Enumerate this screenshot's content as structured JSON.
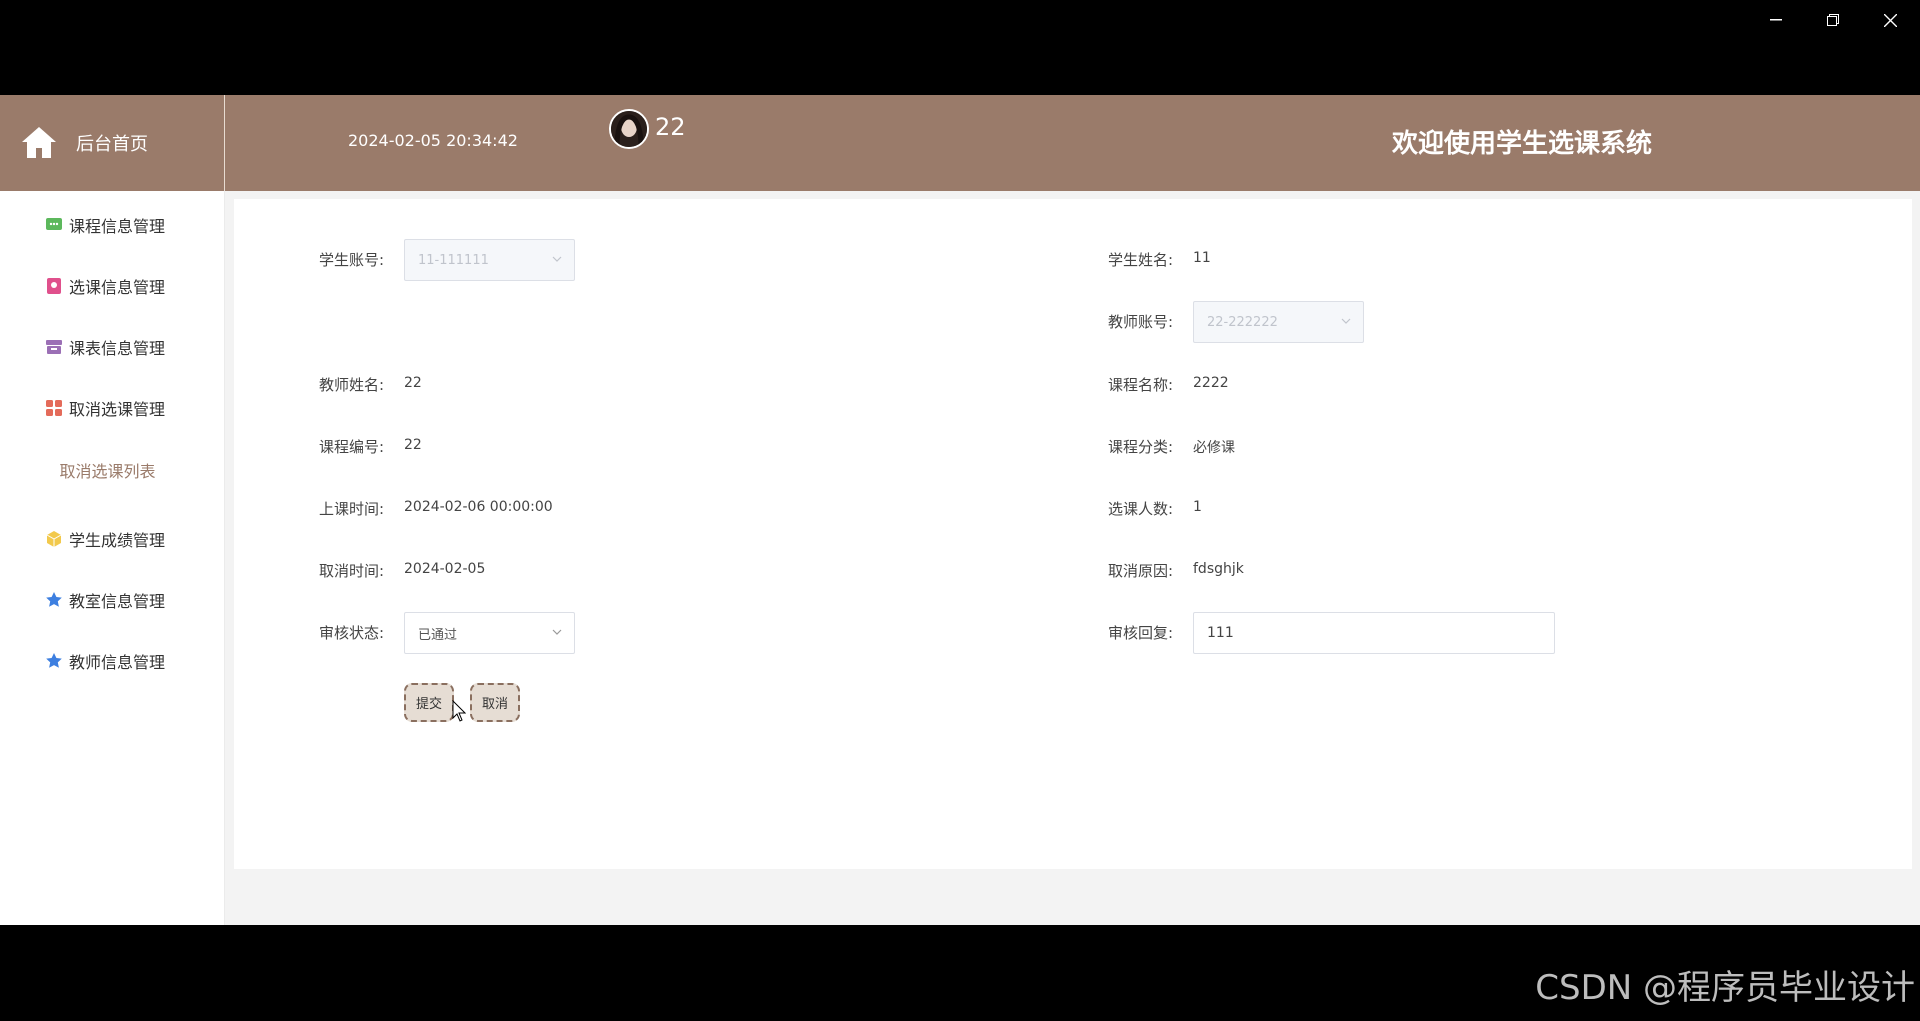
{
  "window": {
    "minimize": "–",
    "restore": "❐",
    "close": "✕"
  },
  "header": {
    "home_label": "后台首页",
    "datetime": "2024-02-05 20:34:42",
    "user_name": "22",
    "welcome": "欢迎使用学生选课系统"
  },
  "sidebar": {
    "items": [
      {
        "label": "课程信息管理",
        "icon": "chat-icon",
        "color": "#5cb85c"
      },
      {
        "label": "选课信息管理",
        "icon": "badge-icon",
        "color": "#e0508c"
      },
      {
        "label": "课表信息管理",
        "icon": "archive-icon",
        "color": "#9b6fb5"
      },
      {
        "label": "取消选课管理",
        "icon": "grid-icon",
        "color": "#e46b5a"
      },
      {
        "sub_label": "取消选课列表"
      },
      {
        "label": "学生成绩管理",
        "icon": "cube-icon",
        "color": "#f2c94c"
      },
      {
        "label": "教室信息管理",
        "icon": "star-icon",
        "color": "#3d7fe0"
      },
      {
        "label": "教师信息管理",
        "icon": "star-icon",
        "color": "#3d7fe0"
      }
    ]
  },
  "form": {
    "student_account": {
      "label": "学生账号:",
      "value": "11-111111"
    },
    "student_name": {
      "label": "学生姓名:",
      "value": "11"
    },
    "teacher_account": {
      "label": "教师账号:",
      "value": "22-222222"
    },
    "teacher_name": {
      "label": "教师姓名:",
      "value": "22"
    },
    "course_name": {
      "label": "课程名称:",
      "value": "2222"
    },
    "course_code": {
      "label": "课程编号:",
      "value": "22"
    },
    "course_category": {
      "label": "课程分类:",
      "value": "必修课"
    },
    "class_time": {
      "label": "上课时间:",
      "value": "2024-02-06 00:00:00"
    },
    "enrolled_count": {
      "label": "选课人数:",
      "value": "1"
    },
    "cancel_time": {
      "label": "取消时间:",
      "value": "2024-02-05"
    },
    "cancel_reason": {
      "label": "取消原因:",
      "value": "fdsghjk"
    },
    "review_status": {
      "label": "审核状态:",
      "value": "已通过"
    },
    "review_reply": {
      "label": "审核回复:",
      "value": "111"
    },
    "submit_label": "提交",
    "cancel_label": "取消"
  },
  "watermark": "CSDN @程序员毕业设计",
  "colors": {
    "header_bg": "#9a7b6a",
    "accent": "#9a7b6a"
  }
}
